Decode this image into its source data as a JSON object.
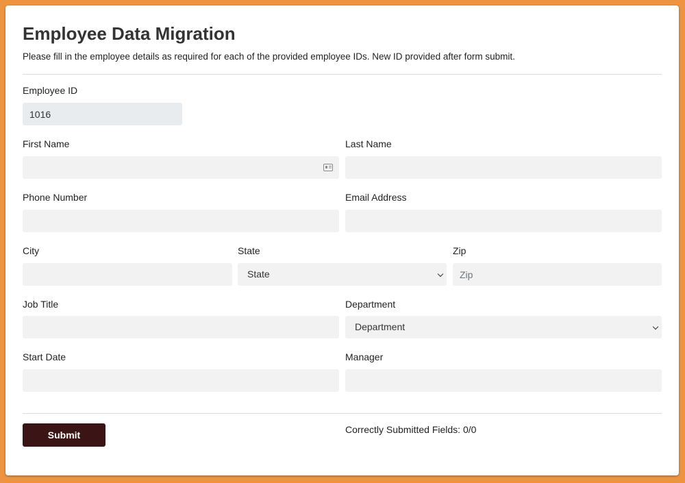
{
  "form": {
    "title": "Employee Data Migration",
    "subtitle": "Please fill in the employee details as required for each of the provided employee IDs. New ID provided after form submit.",
    "employee_id": {
      "label": "Employee ID",
      "value": "1016"
    },
    "first_name": {
      "label": "First Name",
      "value": "",
      "icon": "contact-card-icon"
    },
    "last_name": {
      "label": "Last Name",
      "value": ""
    },
    "phone": {
      "label": "Phone Number",
      "value": ""
    },
    "email": {
      "label": "Email Address",
      "value": ""
    },
    "city": {
      "label": "City",
      "value": ""
    },
    "state": {
      "label": "State",
      "selected": "State"
    },
    "zip": {
      "label": "Zip",
      "placeholder": "Zip",
      "value": ""
    },
    "job_title": {
      "label": "Job Title",
      "value": ""
    },
    "department": {
      "label": "Department",
      "selected": "Department"
    },
    "start_date": {
      "label": "Start Date",
      "value": ""
    },
    "manager": {
      "label": "Manager",
      "value": ""
    },
    "submit_label": "Submit",
    "status": "Correctly Submitted Fields: 0/0"
  },
  "colors": {
    "page_background": "#ee9440",
    "submit_button": "#3b1515",
    "input_background": "#f2f2f2",
    "readonly_background": "#e9ecef"
  }
}
